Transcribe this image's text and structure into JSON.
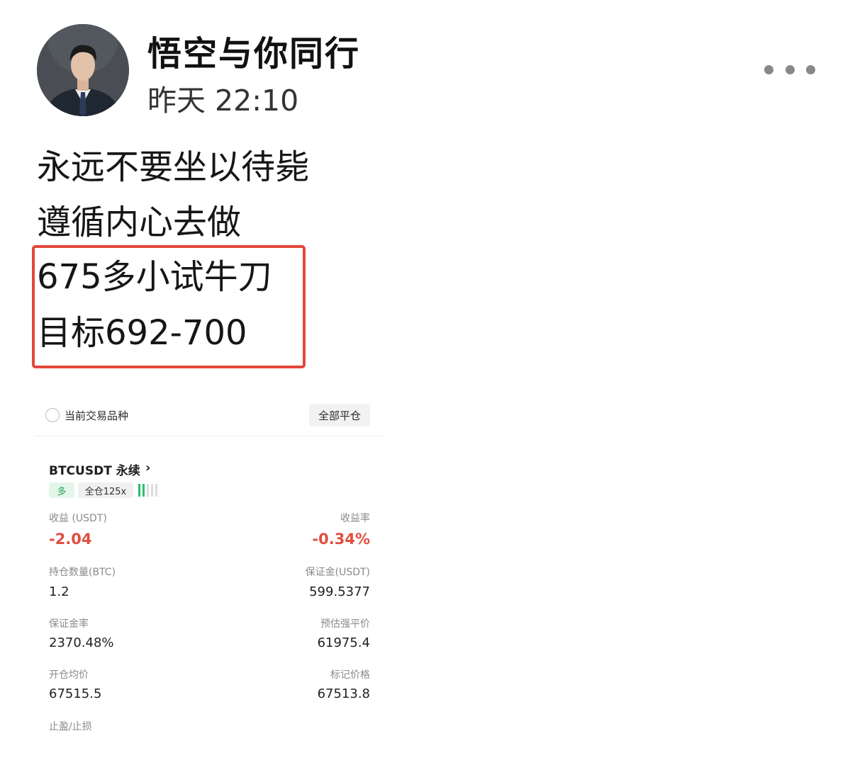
{
  "post": {
    "author": "悟空与你同行",
    "time": "昨天 22:10",
    "lines": [
      "永远不要坐以待毙",
      "遵循内心去做",
      "675多小试牛刀",
      "目标692-700"
    ]
  },
  "colors": {
    "highlight_border": "#e4473b",
    "loss_red": "#e04e3f",
    "long_green": "#2aa45a"
  },
  "icons": {
    "more": "more-horizontal-icon",
    "chevron": "chevron-right-icon",
    "radio": "radio-circle-icon",
    "leverage_level": "signal-bars-icon"
  },
  "trade_card": {
    "filter_label": "当前交易品种",
    "close_all_label": "全部平仓",
    "symbol": "BTCUSDT 永续",
    "chevron": "›",
    "direction_badge": "多",
    "margin_badge": "全仓125x",
    "leverage_level_bars_on": 2,
    "leverage_level_bars_total": 5,
    "pnl_label": "收益 (USDT)",
    "pnl_value": "-2.04",
    "roe_label": "收益率",
    "roe_value": "-0.34%",
    "size_label": "持仓数量(BTC)",
    "size_value": "1.2",
    "margin_label": "保证金(USDT)",
    "margin_value": "599.5377",
    "margin_ratio_label": "保证金率",
    "margin_ratio_value": "2370.48%",
    "liq_price_label": "预估强平价",
    "liq_price_value": "61975.4",
    "entry_price_label": "开仓均价",
    "entry_price_value": "67515.5",
    "mark_price_label": "标记价格",
    "mark_price_value": "67513.8",
    "tpsl_label": "止盈/止损"
  }
}
